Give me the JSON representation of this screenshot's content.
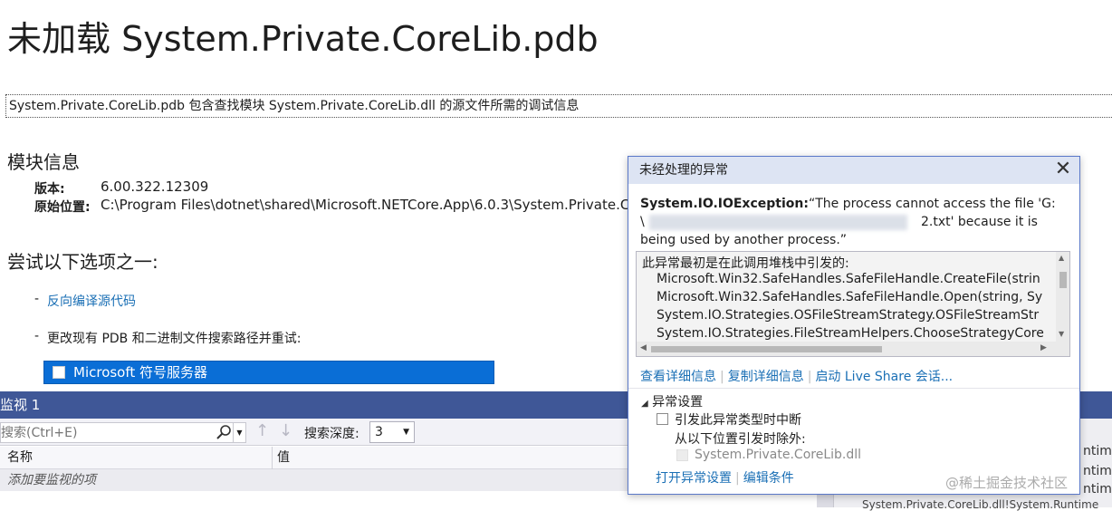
{
  "document": {
    "title": "未加载 System.Private.CoreLib.pdb",
    "description": "System.Private.CoreLib.pdb 包含查找模块 System.Private.CoreLib.dll 的源文件所需的调试信息",
    "module_info_heading": "模块信息",
    "version_label": "版本:",
    "version_value": "6.00.322.12309",
    "location_label": "原始位置:",
    "location_value": "C:\\Program Files\\dotnet\\shared\\Microsoft.NETCore.App\\6.0.3\\System.Private.Co",
    "try_heading": "尝试以下选项之一:",
    "option_decompile": "反向编译源代码",
    "option_change_path": "更改现有 PDB 和二进制文件搜索路径并重试:",
    "symbol_server": "Microsoft 符号服务器",
    "bullet": "-"
  },
  "watch": {
    "title": "监视 1",
    "search_placeholder": "搜索(Ctrl+E)",
    "depth_label": "搜索深度:",
    "depth_value": "3",
    "col_name": "名称",
    "col_value": "值",
    "add_item": "添加要监视的项",
    "right_text_1": "ntime",
    "right_text_2": "ntime",
    "right_text_3": "ntime",
    "right_bottom": "System.Private.CoreLib.dll!System.Runtime"
  },
  "exception_popup": {
    "title": "未经处理的异常",
    "exception_type": "System.IO.IOException:",
    "message_line1": "“The process cannot access the file 'G:",
    "message_line2_start": "\\",
    "message_line2_end": "2.txt' because it is",
    "message_line3": "being used by another process.”",
    "stack_heading": "此异常最初是在此调用堆栈中引发的:",
    "stack_frames": [
      "Microsoft.Win32.SafeHandles.SafeFileHandle.CreateFile(strin",
      "Microsoft.Win32.SafeHandles.SafeFileHandle.Open(string, Sy",
      "System.IO.Strategies.OSFileStreamStrategy.OSFileStreamStr",
      "System.IO.Strategies.FileStreamHelpers.ChooseStrategyCore"
    ],
    "link_view_details": "查看详细信息",
    "link_copy_details": "复制详细信息",
    "link_live_share": "启动 Live Share 会话...",
    "settings_heading": "异常设置",
    "break_when_thrown": "引发此异常类型时中断",
    "except_when_from": "从以下位置引发时除外:",
    "except_module": "System.Private.CoreLib.dll",
    "link_open_settings": "打开异常设置",
    "link_edit_conditions": "编辑条件"
  },
  "watermark": "@稀土掘金技术社区",
  "colors": {
    "accent_blue": "#0a6ed6",
    "watch_title_bg": "#3f5797",
    "link": "#1a6fb5",
    "popup_header": "#dde4f3"
  }
}
